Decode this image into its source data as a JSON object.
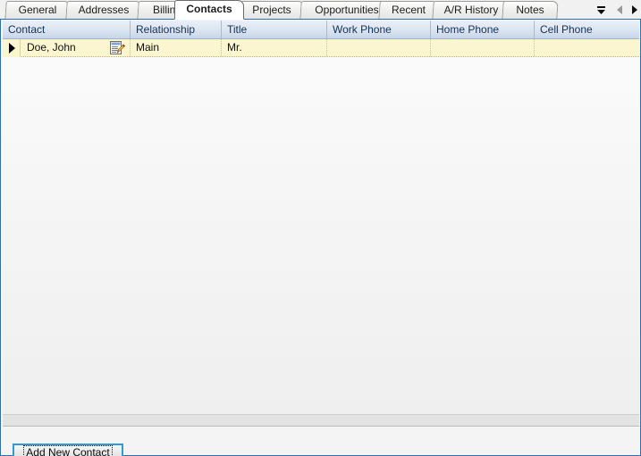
{
  "window": {
    "accent_color": "#2f6fab",
    "tab_active_color": "#ffffff",
    "header_color": "#c6d4e8",
    "row_highlight_color": "#fbf6cf",
    "button_focus_color": "#2e9bd6"
  },
  "tabs": [
    {
      "label": "General",
      "active": false
    },
    {
      "label": "Addresses",
      "active": false
    },
    {
      "label": "Billing",
      "active": false
    },
    {
      "label": "Contacts",
      "active": true
    },
    {
      "label": "Projects",
      "active": false
    },
    {
      "label": "Opportunities",
      "active": false
    },
    {
      "label": "Recent",
      "active": false
    },
    {
      "label": "A/R History",
      "active": false
    },
    {
      "label": "Notes",
      "active": false
    }
  ],
  "tab_nav": {
    "dropdown_icon": "tab-list-dropdown-icon",
    "prev_icon": "scroll-tabs-left-icon",
    "next_icon": "scroll-tabs-right-icon"
  },
  "grid": {
    "row_indicator_icon": "current-row-arrow-icon",
    "edit_icon": "edit-contact-icon",
    "columns": [
      {
        "label": "Contact"
      },
      {
        "label": "Relationship"
      },
      {
        "label": "Title"
      },
      {
        "label": "Work Phone"
      },
      {
        "label": "Home Phone"
      },
      {
        "label": "Cell Phone"
      }
    ],
    "rows": [
      {
        "contact": "Doe, John",
        "relationship": "Main",
        "title": "Mr.",
        "work_phone": "",
        "home_phone": "",
        "cell_phone": ""
      }
    ]
  },
  "footer": {
    "add_new_contact_label": "Add New Contact"
  }
}
